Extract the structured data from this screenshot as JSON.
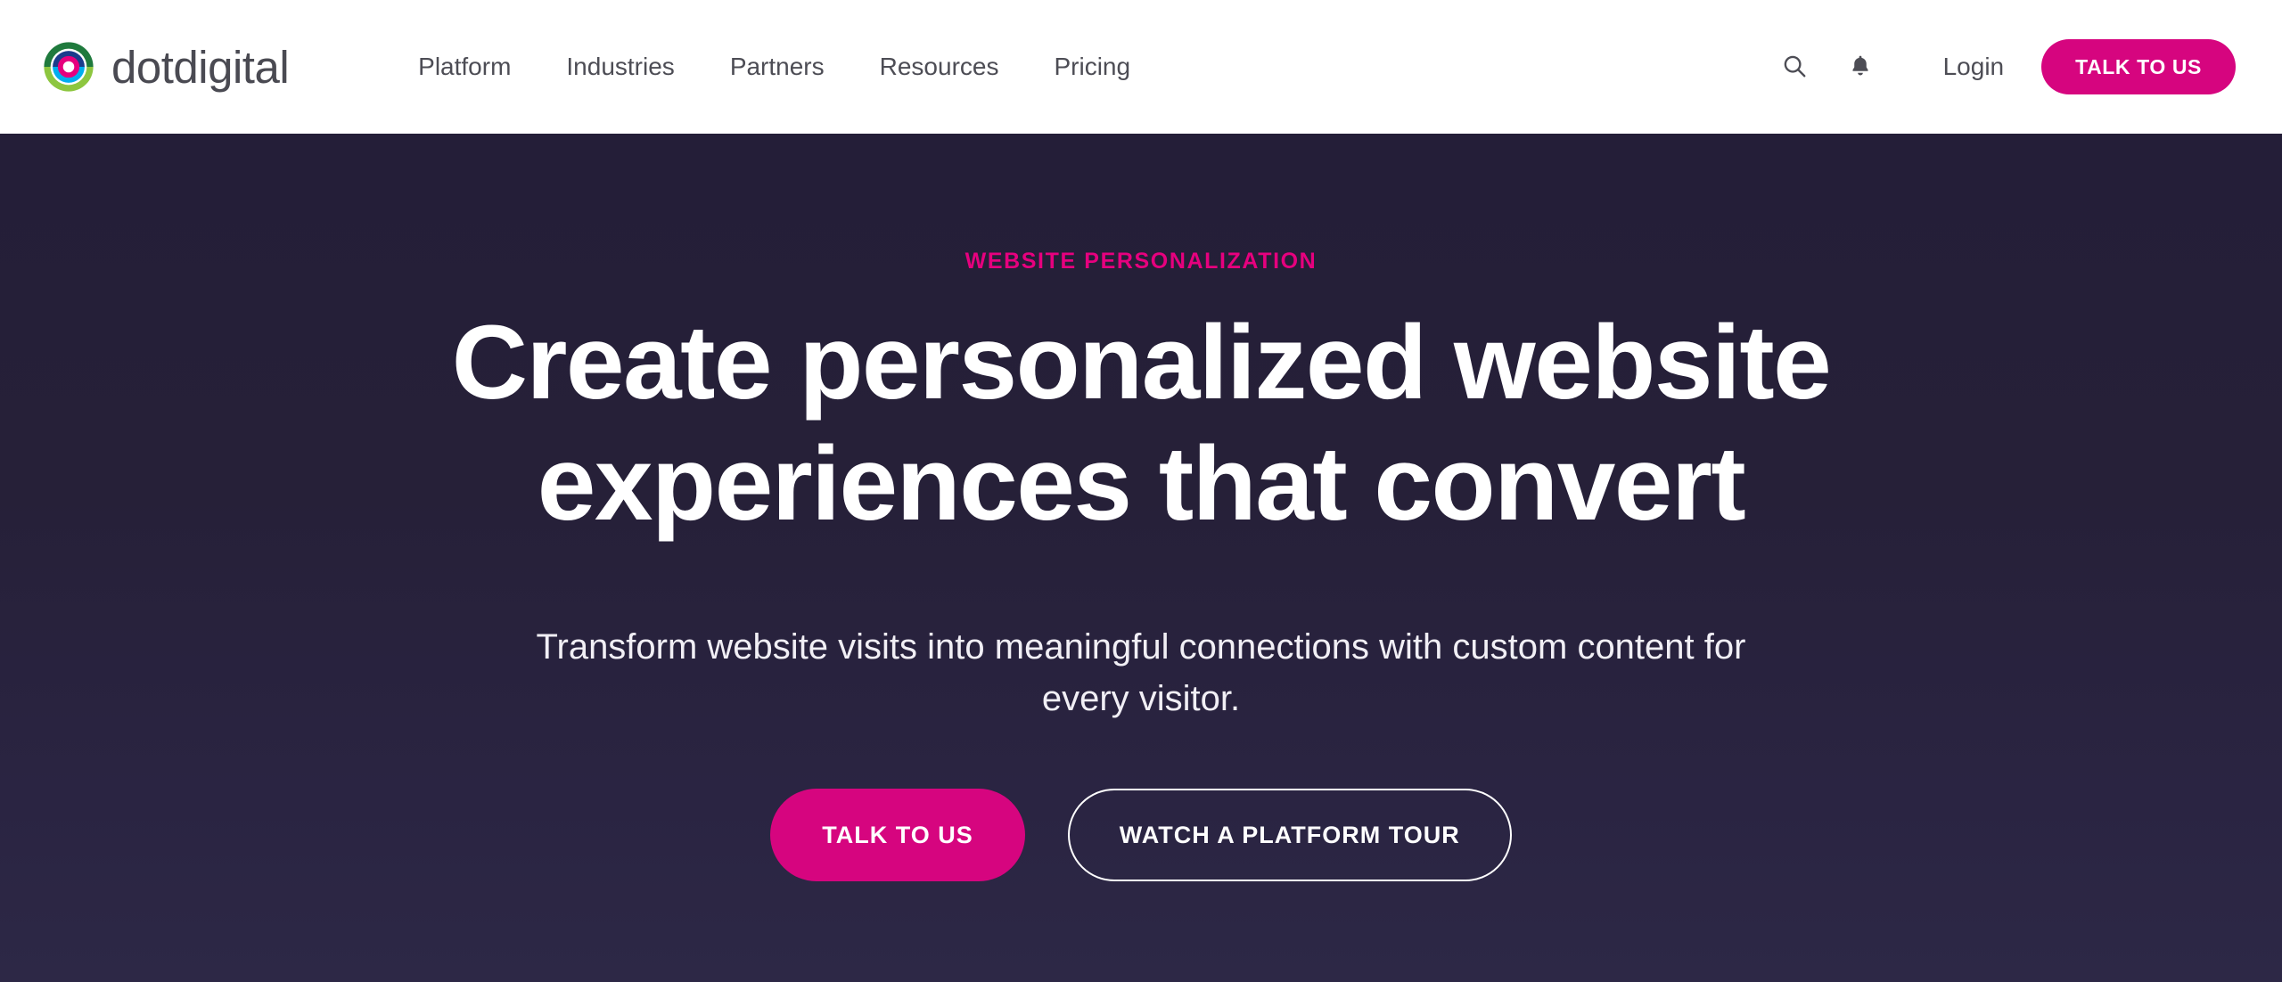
{
  "brand": {
    "name": "dotdigital",
    "logo_icon": "dotdigital-target-logo-icon",
    "logo_colors": {
      "ring_outer_dark": "#1F7A3D",
      "ring_outer_light": "#8DC63F",
      "ring_mid_dark": "#1B3C8C",
      "ring_mid_light": "#00AEEF",
      "ring_inner": "#E6007E",
      "wordmark": "#4A4A52"
    }
  },
  "header": {
    "nav": [
      {
        "label": "Platform",
        "name": "nav-link-platform"
      },
      {
        "label": "Industries",
        "name": "nav-link-industries"
      },
      {
        "label": "Partners",
        "name": "nav-link-partners"
      },
      {
        "label": "Resources",
        "name": "nav-link-resources"
      },
      {
        "label": "Pricing",
        "name": "nav-link-pricing"
      }
    ],
    "search_icon": "search-icon",
    "notifications_icon": "bell-icon",
    "login_label": "Login",
    "cta_label": "TALK TO US",
    "background": "#FFFFFF",
    "text_color": "#4D4D55"
  },
  "hero": {
    "eyebrow": "WEBSITE PERSONALIZATION",
    "title_line_1": "Create personalized website",
    "title_line_2": "experiences that convert",
    "subtitle": "Transform website visits into meaningful connections with custom content for every visitor.",
    "primary_cta": "TALK TO US",
    "secondary_cta": "WATCH A PLATFORM TOUR",
    "background_top": "#241E38",
    "background_bottom": "#2D2846",
    "accent_color": "#E6007E",
    "cta_color": "#D6057F",
    "text_color": "#FFFFFF"
  }
}
